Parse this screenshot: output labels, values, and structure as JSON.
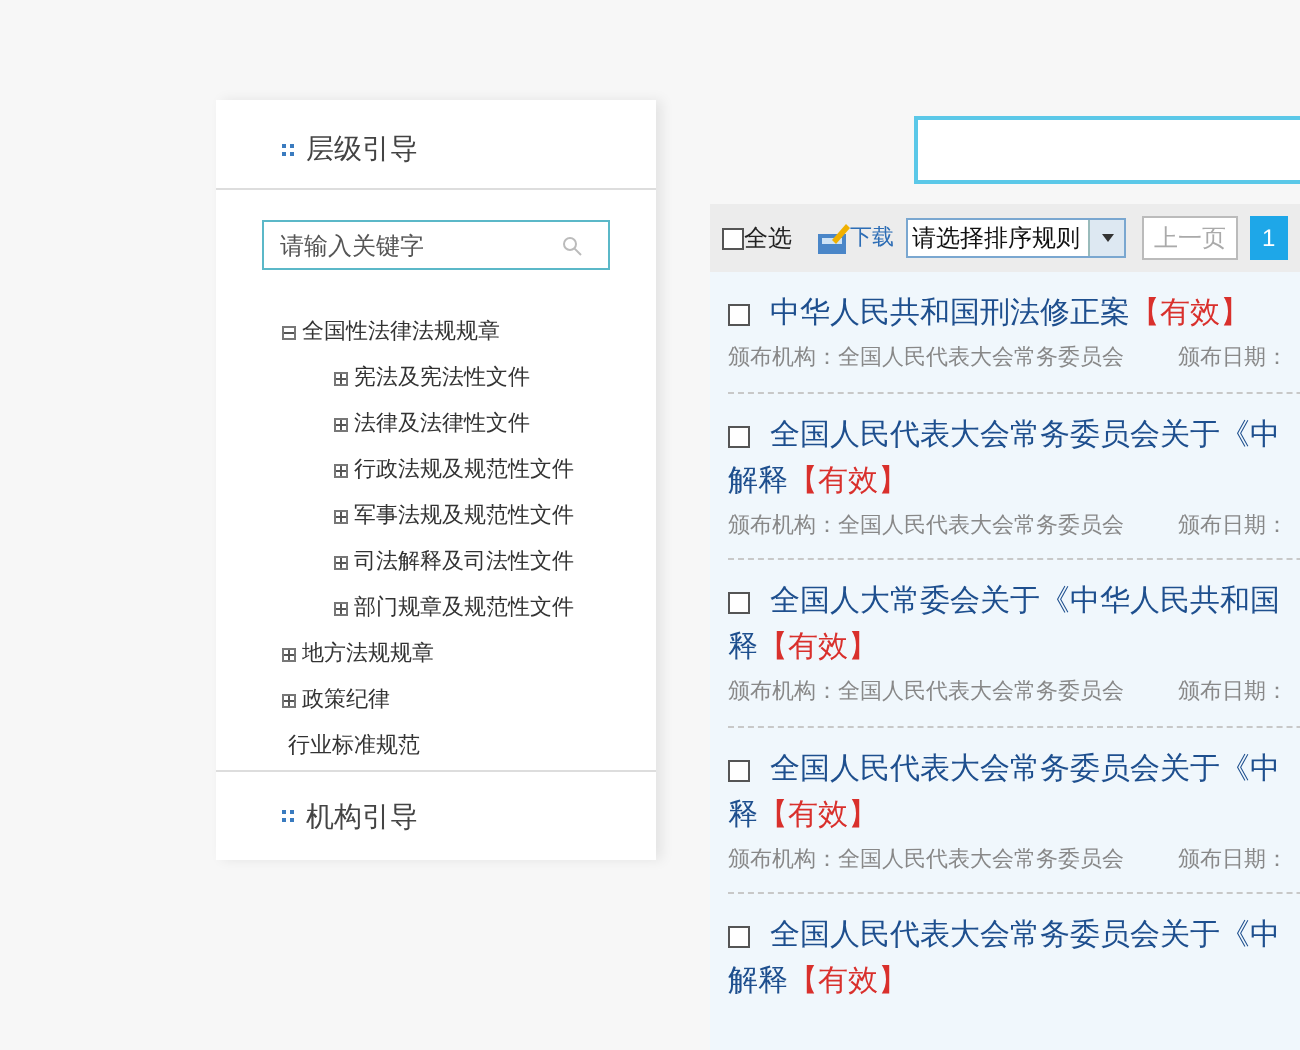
{
  "sidebar": {
    "sections": [
      {
        "title": "层级引导"
      },
      {
        "title": "机构引导"
      }
    ],
    "search": {
      "placeholder": "请输入关键字"
    },
    "tree": [
      {
        "label": "全国性法律法规规章",
        "kind": "folder",
        "expanded": true,
        "children": [
          {
            "label": "宪法及宪法性文件",
            "kind": "folder",
            "expanded": false
          },
          {
            "label": "法律及法律性文件",
            "kind": "folder",
            "expanded": false
          },
          {
            "label": "行政法规及规范性文件",
            "kind": "folder",
            "expanded": false
          },
          {
            "label": "军事法规及规范性文件",
            "kind": "folder",
            "expanded": false
          },
          {
            "label": "司法解释及司法性文件",
            "kind": "folder",
            "expanded": false
          },
          {
            "label": "部门规章及规范性文件",
            "kind": "folder",
            "expanded": false
          }
        ]
      },
      {
        "label": "地方法规规章",
        "kind": "folder",
        "expanded": false
      },
      {
        "label": "政策纪律",
        "kind": "folder",
        "expanded": false
      },
      {
        "label": "行业标准规范",
        "kind": "leaf",
        "expanded": false
      }
    ]
  },
  "toolbar": {
    "select_all": {
      "label": "全选",
      "checked": false
    },
    "download": "下载",
    "sort": {
      "value": "请选择排序规则"
    },
    "prev_page": "上一页",
    "pages": [
      {
        "label": "1",
        "selected": true
      }
    ]
  },
  "results": [
    {
      "title_lines": [
        "中华人民共和国刑法修正案"
      ],
      "status": "【有效】",
      "checked": false,
      "publisher": "颁布机构：全国人民代表大会常务委员会",
      "date_label": "颁布日期："
    },
    {
      "title_lines": [
        "全国人民代表大会常务委员会关于《中",
        "解释"
      ],
      "status": "【有效】",
      "checked": false,
      "publisher": "颁布机构：全国人民代表大会常务委员会",
      "date_label": "颁布日期："
    },
    {
      "title_lines": [
        "全国人大常委会关于《中华人民共和国",
        "释"
      ],
      "status": "【有效】",
      "checked": false,
      "publisher": "颁布机构：全国人民代表大会常务委员会",
      "date_label": "颁布日期："
    },
    {
      "title_lines": [
        "全国人民代表大会常务委员会关于《中",
        "释"
      ],
      "status": "【有效】",
      "checked": false,
      "publisher": "颁布机构：全国人民代表大会常务委员会",
      "date_label": "颁布日期："
    },
    {
      "title_lines": [
        "全国人民代表大会常务委员会关于《中",
        "解释"
      ],
      "status": "【有效】",
      "checked": false
    }
  ]
}
